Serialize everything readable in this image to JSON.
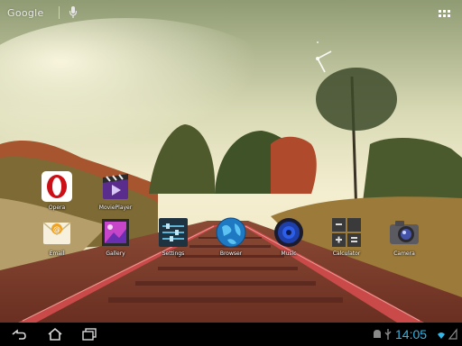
{
  "search": {
    "label": "Google"
  },
  "apps": [
    {
      "label": "Opera",
      "icon": "opera-icon"
    },
    {
      "label": "MoviePlayer",
      "icon": "movieplayer-icon"
    },
    {
      "label": "Email",
      "icon": "email-icon"
    },
    {
      "label": "Gallery",
      "icon": "gallery-icon"
    },
    {
      "label": "Settings",
      "icon": "settings-icon"
    },
    {
      "label": "Browser",
      "icon": "browser-icon"
    },
    {
      "label": "Music",
      "icon": "music-icon"
    },
    {
      "label": "Calculator",
      "icon": "calculator-icon"
    },
    {
      "label": "Camera",
      "icon": "camera-icon"
    }
  ],
  "status": {
    "time": "14:05"
  },
  "colors": {
    "accent": "#33b5e5",
    "opera": "#cc0f16"
  }
}
